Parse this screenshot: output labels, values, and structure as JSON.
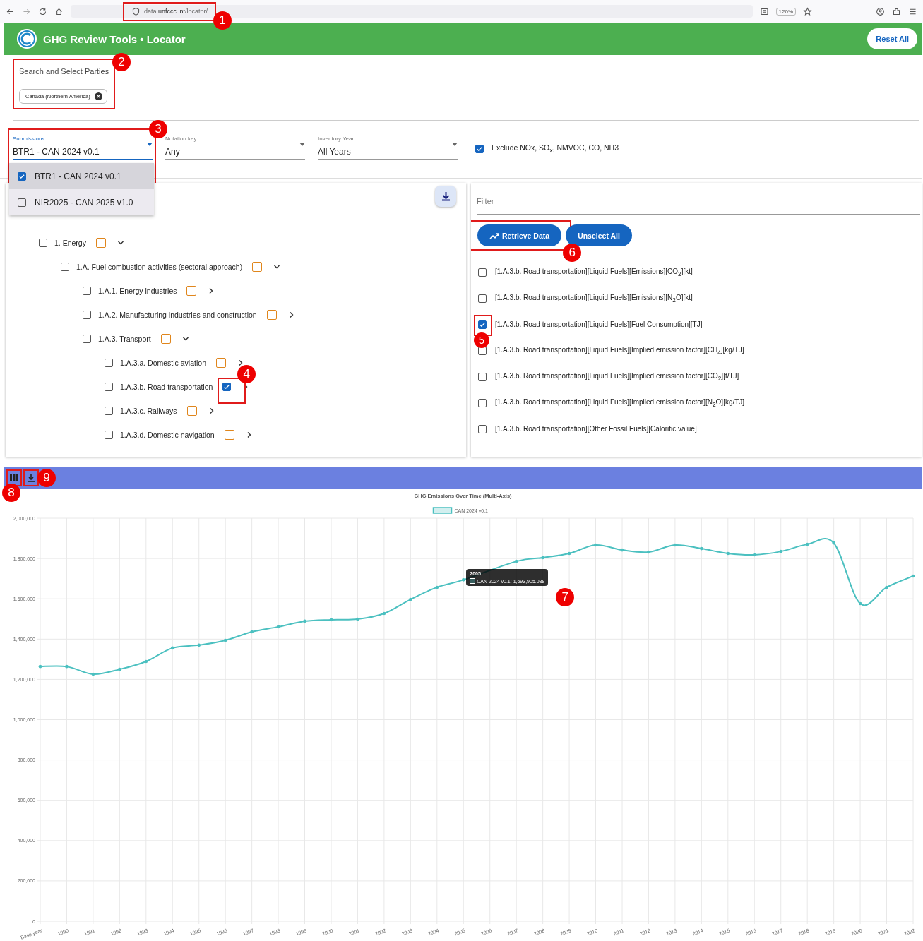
{
  "browser": {
    "url": "data.**unfccc.int**/locator/",
    "zoom": "120%",
    "callout": "1"
  },
  "app_bar": {
    "title": "GHG Review Tools • Locator",
    "reset_button": "Reset All"
  },
  "parties": {
    "label": "Search and Select Parties",
    "chips": [
      {
        "label": "Canada (Northern America)"
      }
    ],
    "callout": "2"
  },
  "filters": {
    "submissions": {
      "label": "Submissions",
      "value": "BTR1 - CAN 2024 v0.1",
      "expanded": true,
      "callout": "3",
      "options": [
        {
          "label": "BTR1 - CAN 2024 v0.1",
          "selected": true
        },
        {
          "label": "NIR2025 - CAN 2025 v1.0",
          "selected": false
        }
      ]
    },
    "notation_key": {
      "label": "Notation key",
      "value": "Any"
    },
    "inventory_year": {
      "label": "Inventory Year",
      "value": "All Years"
    },
    "exclude": {
      "label": "Exclude NOx, SO$_{x}$, NMVOC, CO, NH3",
      "checked": true
    }
  },
  "tree": [
    {
      "label": "1. Energy",
      "checked": false,
      "flagged": false,
      "expanded": true,
      "children": [
        {
          "label": "1.A. Fuel combustion activities (sectoral approach)",
          "checked": false,
          "flagged": false,
          "expanded": true,
          "children": [
            {
              "label": "1.A.1. Energy industries",
              "checked": false,
              "flagged": false,
              "expanded": false
            },
            {
              "label": "1.A.2. Manufacturing industries and construction",
              "checked": false,
              "flagged": false,
              "expanded": false
            },
            {
              "label": "1.A.3. Transport",
              "checked": false,
              "flagged": false,
              "expanded": true,
              "children": [
                {
                  "label": "1.A.3.a. Domestic aviation",
                  "checked": false,
                  "flagged": false,
                  "expanded": false
                },
                {
                  "label": "1.A.3.b. Road transportation",
                  "checked": false,
                  "flagged": true,
                  "expanded": false,
                  "callout": "4"
                },
                {
                  "label": "1.A.3.c. Railways",
                  "checked": false,
                  "flagged": false,
                  "expanded": false
                },
                {
                  "label": "1.A.3.d. Domestic navigation",
                  "checked": false,
                  "flagged": false,
                  "expanded": false
                }
              ]
            }
          ]
        }
      ]
    }
  ],
  "variables": {
    "filter_placeholder": "Filter",
    "retrieve_button": "Retrieve Data",
    "retrieve_callout": "6",
    "unselect_button": "Unselect All",
    "items": [
      {
        "label": "[1.A.3.b. Road transportation][Liquid Fuels][Emissions][CO$_{2}$][kt]",
        "checked": false
      },
      {
        "label": "[1.A.3.b. Road transportation][Liquid Fuels][Emissions][N$_{2}$O][kt]",
        "checked": false
      },
      {
        "label": "[1.A.3.b. Road transportation][Liquid Fuels][Fuel Consumption][TJ]",
        "checked": true,
        "callout": "5"
      },
      {
        "label": "[1.A.3.b. Road transportation][Liquid Fuels][Implied emission factor][CH$_{4}$][kg/TJ]",
        "checked": false
      },
      {
        "label": "[1.A.3.b. Road transportation][Liquid Fuels][Implied emission factor][CO$_{2}$][t/TJ]",
        "checked": false
      },
      {
        "label": "[1.A.3.b. Road transportation][Liquid Fuels][Implied emission factor][N$_{2}$O][kg/TJ]",
        "checked": false
      },
      {
        "label": "[1.A.3.b. Road transportation][Other Fossil Fuels][Calorific value]",
        "checked": false
      }
    ]
  },
  "chart_toolbar": {
    "buttons": [
      {
        "kind": "columns",
        "callout": "8"
      },
      {
        "kind": "download",
        "callout": "9"
      }
    ]
  },
  "chart": {
    "chart_data": {
      "type": "line",
      "title": "GHG Emissions Over Time (Multi-Axis)",
      "categories": [
        "Base year",
        "1990",
        "1991",
        "1992",
        "1993",
        "1994",
        "1995",
        "1996",
        "1997",
        "1998",
        "1999",
        "2000",
        "2001",
        "2002",
        "2003",
        "2004",
        "2005",
        "2006",
        "2007",
        "2008",
        "2009",
        "2010",
        "2011",
        "2012",
        "2013",
        "2014",
        "2015",
        "2016",
        "2017",
        "2018",
        "2019",
        "2020",
        "2021",
        "2022"
      ],
      "series": [
        {
          "name": "CAN 2024 v0.1",
          "color": "#4bc0c0",
          "values": [
            1264000,
            1264000,
            1226000,
            1250000,
            1289000,
            1356000,
            1370000,
            1394000,
            1436000,
            1461000,
            1489000,
            1496000,
            1499000,
            1527000,
            1597000,
            1657000,
            1694000,
            null,
            1786000,
            1804000,
            1825000,
            1867000,
            1842000,
            1832000,
            1867000,
            1849000,
            1825000,
            1818000,
            1835000,
            1870000,
            1877000,
            1576000,
            1657000,
            1713000
          ]
        }
      ],
      "ylim": [
        0,
        2000000
      ],
      "grid": true,
      "yticks": [
        {
          "value": 0,
          "label": "0"
        },
        {
          "value": 200000,
          "label": "200,000"
        },
        {
          "value": 400000,
          "label": "400,000"
        },
        {
          "value": 600000,
          "label": "600,000"
        },
        {
          "value": 800000,
          "label": "800,000"
        },
        {
          "value": 1000000,
          "label": "1,000,000"
        },
        {
          "value": 1200000,
          "label": "1,200,000"
        },
        {
          "value": 1400000,
          "label": "1,400,000"
        },
        {
          "value": 1600000,
          "label": "1,600,000"
        },
        {
          "value": 1800000,
          "label": "1,800,000"
        },
        {
          "value": 2000000,
          "label": "2,000,000"
        }
      ]
    },
    "tooltip": {
      "title": "2005",
      "body": "CAN 2024 v0.1: 1,693,905.038",
      "callout": "7"
    }
  }
}
